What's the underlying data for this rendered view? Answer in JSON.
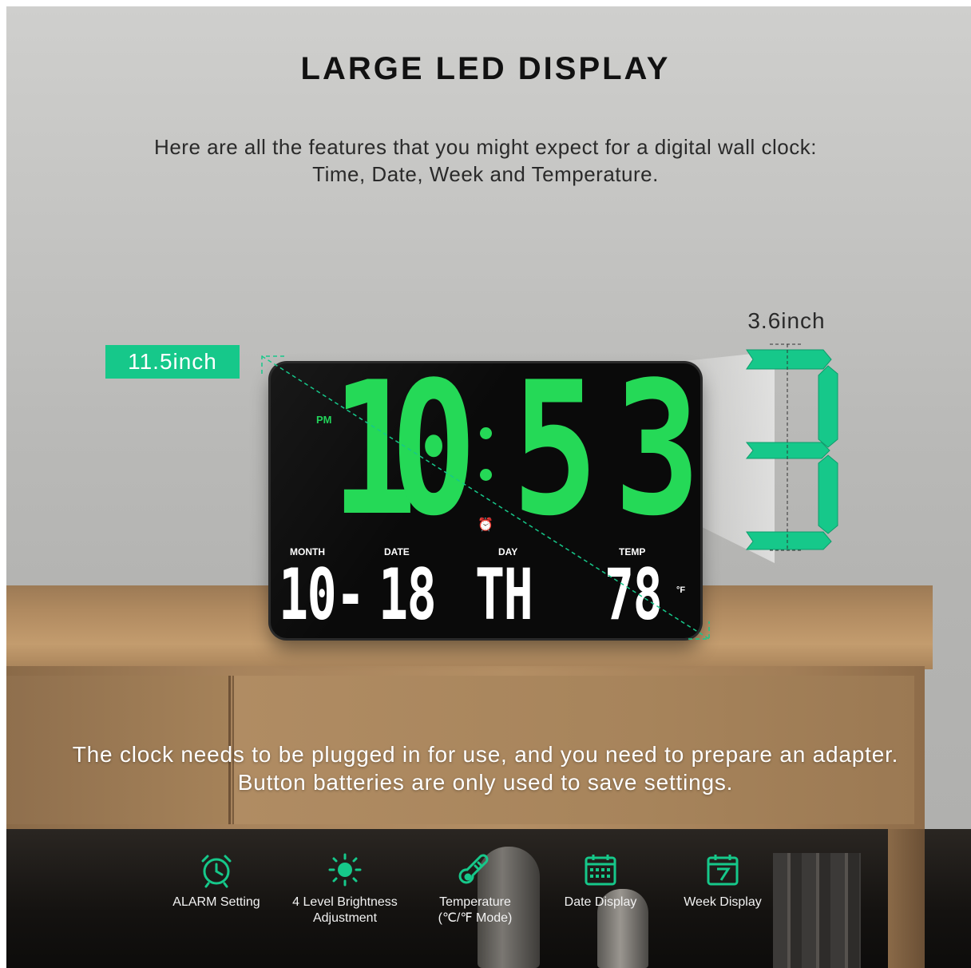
{
  "heading": "LARGE LED DISPLAY",
  "subtitle": [
    "Here are all the features that you might expect for a digital wall clock:",
    "Time, Date, Week and Temperature."
  ],
  "dimensions": {
    "width": "11.5inch",
    "height": "3.6inch"
  },
  "clock": {
    "period": "PM",
    "hour": [
      "1",
      "0"
    ],
    "minute": [
      "5",
      "3"
    ],
    "labels": {
      "month": "MONTH",
      "date": "DATE",
      "day": "DAY",
      "temp": "TEMP"
    },
    "month_value": "10-",
    "date_value": "18",
    "day_value": "TH",
    "temp_value": "78",
    "temp_unit": "°F",
    "segment_digit": "3"
  },
  "notice": [
    "The clock needs to be plugged in for use, and you need to prepare an adapter.",
    "Button batteries are only used to save settings."
  ],
  "features": [
    {
      "icon": "alarm-clock-icon",
      "label": "ALARM Setting"
    },
    {
      "icon": "sun-brightness-icon",
      "label": "4 Level Brightness\nAdjustment"
    },
    {
      "icon": "thermometer-icon",
      "label": "Temperature\n(℃/℉ Mode)"
    },
    {
      "icon": "calendar-icon",
      "label": "Date Display"
    },
    {
      "icon": "calendar-seven-icon",
      "label": "Week Display"
    }
  ],
  "colors": {
    "accent": "#16c88a",
    "led_green": "#25d957",
    "led_white": "#ffffff"
  }
}
